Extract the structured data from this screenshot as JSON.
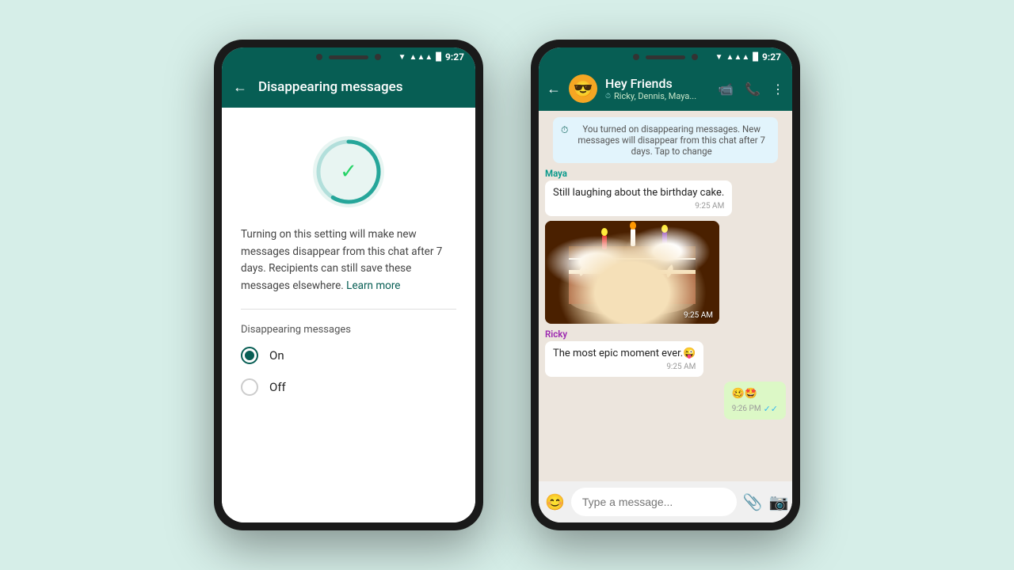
{
  "background_color": "#d6eee8",
  "phone1": {
    "status_bar": {
      "time": "9:27"
    },
    "header": {
      "back_label": "←",
      "title": "Disappearing messages"
    },
    "timer_icon": "✓",
    "description": "Turning on this setting will make new messages disappear from this chat after 7 days. Recipients can still save these messages elsewhere.",
    "learn_more_label": "Learn more",
    "section_title": "Disappearing messages",
    "radio_on_label": "On",
    "radio_off_label": "Off",
    "selected_option": "on"
  },
  "phone2": {
    "status_bar": {
      "time": "9:27"
    },
    "header": {
      "back_label": "←",
      "group_name": "Hey Friends",
      "group_subtitle": "Ricky, Dennis, Maya...",
      "avatar_emoji": "😎"
    },
    "system_message": "You turned on disappearing messages. New messages will disappear from this chat after 7 days. Tap to change",
    "messages": [
      {
        "id": "maya-text",
        "sender": "Maya",
        "sender_color": "teal",
        "text": "Still laughing about the birthday cake.",
        "time": "9:25 AM",
        "type": "text",
        "direction": "incoming"
      },
      {
        "id": "maya-image",
        "sender": "Maya",
        "time": "9:25 AM",
        "type": "image",
        "direction": "incoming"
      },
      {
        "id": "ricky-text",
        "sender": "Ricky",
        "sender_color": "purple",
        "text": "The most epic moment ever.😜",
        "time": "9:25 AM",
        "type": "text",
        "direction": "incoming"
      },
      {
        "id": "outgoing-emoji",
        "text": "🥴🤩",
        "time": "9:26 PM",
        "type": "text",
        "direction": "outgoing"
      }
    ],
    "input_placeholder": "Type a message..."
  }
}
